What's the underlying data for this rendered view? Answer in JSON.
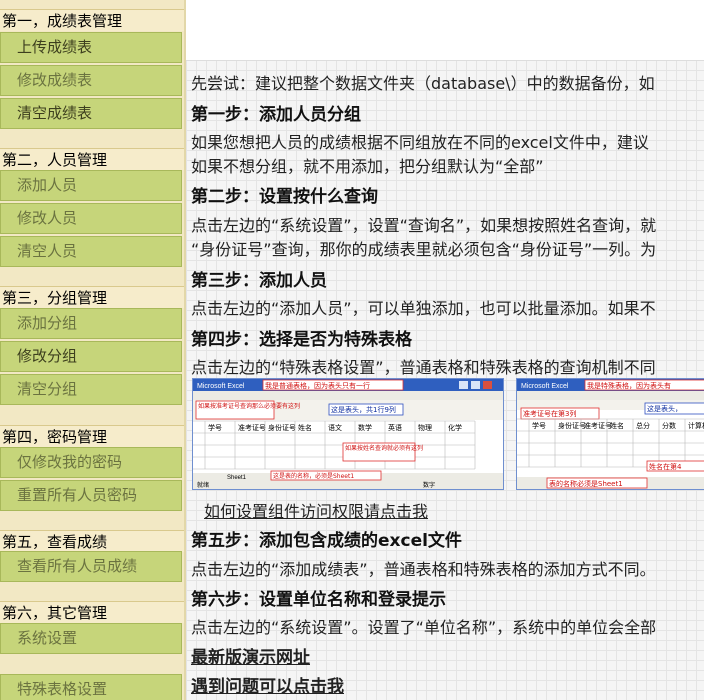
{
  "sidebar": {
    "sections": [
      {
        "title": "第一，成绩表管理",
        "items": [
          {
            "label": "上传成绩表",
            "tone": "dark"
          },
          {
            "label": "修改成绩表",
            "tone": "light"
          },
          {
            "label": "清空成绩表",
            "tone": "dark"
          }
        ]
      },
      {
        "title": "第二，人员管理",
        "items": [
          {
            "label": "添加人员",
            "tone": "light"
          },
          {
            "label": "修改人员",
            "tone": "light"
          },
          {
            "label": "清空人员",
            "tone": "light"
          }
        ]
      },
      {
        "title": "第三，分组管理",
        "items": [
          {
            "label": "添加分组",
            "tone": "light"
          },
          {
            "label": "修改分组",
            "tone": "dark"
          },
          {
            "label": "清空分组",
            "tone": "light"
          }
        ]
      },
      {
        "title": "第四，密码管理",
        "items": [
          {
            "label": "仅修改我的密码",
            "tone": "light"
          },
          {
            "label": "重置所有人员密码",
            "tone": "light"
          }
        ]
      },
      {
        "title": "第五，查看成绩",
        "items": [
          {
            "label": "查看所有人员成绩",
            "tone": "light"
          }
        ]
      },
      {
        "title": "第六，其它管理",
        "items": [
          {
            "label": "系统设置",
            "tone": "light"
          },
          {
            "label": "特殊表格设置",
            "tone": "light"
          }
        ]
      }
    ]
  },
  "content": {
    "intro": "先尝试：建议把整个数据文件夹（database\\）中的数据备份，如",
    "step1_title": "第一步：添加人员分组",
    "step1_line1": "如果您想把人员的成绩根据不同组放在不同的excel文件中，建议",
    "step1_line2": "如果不想分组，就不用添加，把分组默认为“全部”",
    "step2_title": "第二步：设置按什么查询",
    "step2_line1": "点击左边的“系统设置”，设置“查询名”，如果想按照姓名查询，就",
    "step2_line2": "“身份证号”查询，那你的成绩表里就必须包含“身份证号”一列。为",
    "step3_title": "第三步：添加人员",
    "step3_line1": "点击左边的“添加人员”，可以单独添加，也可以批量添加。如果不",
    "step4_title": "第四步：选择是否为特殊表格",
    "step4_line1": "点击左边的“特殊表格设置”，普通表格和特殊表格的查询机制不同",
    "permission_link": "如何设置组件访问权限请点击我",
    "step5_title": "第五步：添加包含成绩的excel文件",
    "step5_line1": "点击左边的“添加成绩表”，普通表格和特殊表格的添加方式不同。",
    "step6_title": "第六步：设置单位名称和登录提示",
    "step6_line1": "点击左边的“系统设置”。设置了“单位名称”，系统中的单位会全部",
    "demo_link": "最新版演示网址",
    "help_link": "遇到问题可以点击我"
  },
  "screenshot_left": {
    "title_bar": "Microsoft Excel",
    "note_top": "我是普通表格，因为表头只有一行",
    "note_left": "如果按准考证号查询那么必须要有这列",
    "note_header": "这是表头，共1行9列",
    "headers": [
      "学号",
      "准考证号",
      "身份证号",
      "姓名",
      "语文",
      "数学",
      "英语",
      "物理",
      "化学"
    ],
    "note_name": "如果按姓名查询就必须有这列",
    "note_sheet": "这是表的名称，必须是Sheet1",
    "sheet_tab": "Sheet1",
    "status_left": "就绪",
    "status_right": "数字"
  },
  "screenshot_right": {
    "title_bar": "Microsoft Excel",
    "note_top": "我是特殊表格，因为表头有",
    "note_left": "准考证号在第3列",
    "note_header": "这是表头，",
    "headers": [
      "学号",
      "身份证号",
      "准考证号",
      "姓名",
      "总分",
      "分数",
      "计算机"
    ],
    "note_name": "姓名在第4",
    "note_sheet": "表的名称必须是Sheet1",
    "sheet_tab": "Sheet1"
  }
}
